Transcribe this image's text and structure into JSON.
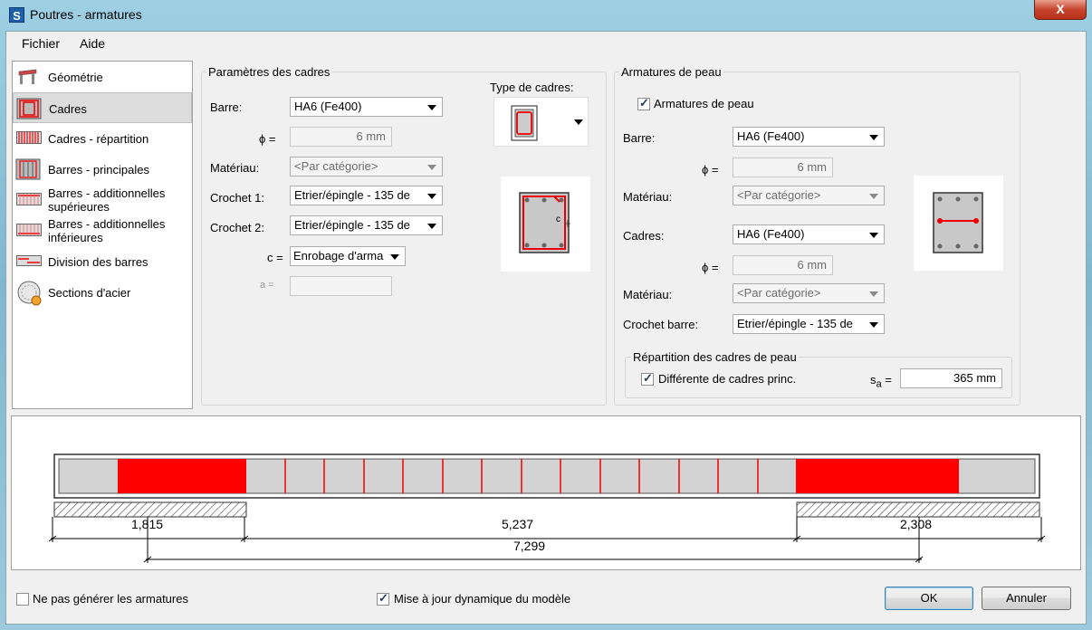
{
  "window": {
    "title": "Poutres - armatures",
    "app_icon": "S",
    "close_glyph": "X"
  },
  "menu": [
    "Fichier",
    "Aide"
  ],
  "nav": [
    {
      "label": "Géométrie",
      "icon": "geometry-icon"
    },
    {
      "label": "Cadres",
      "icon": "stirrups-icon",
      "selected": true
    },
    {
      "label": "Cadres - répartition",
      "icon": "stirrup-distribution-icon"
    },
    {
      "label": "Barres - principales",
      "icon": "main-bars-icon"
    },
    {
      "label": "Barres - additionnelles supérieures",
      "line1": "Barres - additionnelles",
      "line2": "supérieures",
      "icon": "top-bars-icon"
    },
    {
      "label": "Barres - additionnelles inférieures",
      "line1": "Barres - additionnelles",
      "line2": "inférieures",
      "icon": "bottom-bars-icon"
    },
    {
      "label": "Division des barres",
      "icon": "bar-division-icon"
    },
    {
      "label": "Sections d'acier",
      "icon": "steel-sections-icon"
    }
  ],
  "cadres": {
    "group_title": "Paramètres des cadres",
    "barre_label": "Barre:",
    "barre_value": "HA6 (Fe400)",
    "phi_label": "ϕ =",
    "phi_value": "6 mm",
    "materiau_label": "Matériau:",
    "materiau_value": "<Par catégorie>",
    "crochet1_label": "Crochet 1:",
    "crochet1_value": "Etrier/épingle - 135 de",
    "crochet2_label": "Crochet 2:",
    "crochet2_value": "Etrier/épingle - 135 de",
    "c_label": "c =",
    "c_value": "Enrobage d'arma",
    "a_label": "a =",
    "a_value": "",
    "type_label": "Type de cadres:",
    "section_c_label": "c"
  },
  "peau": {
    "group_title": "Armatures de peau",
    "enable_label": "Armatures de peau",
    "enable_checked": true,
    "barre_label": "Barre:",
    "barre_value": "HA6 (Fe400)",
    "phi_label": "ϕ =",
    "phi_value": "6 mm",
    "materiau_label": "Matériau:",
    "materiau_value": "<Par catégorie>",
    "cadres_label": "Cadres:",
    "cadres_value": "HA6 (Fe400)",
    "phi2_label": "ϕ =",
    "phi2_value": "6 mm",
    "materiau2_label": "Matériau:",
    "materiau2_value": "<Par catégorie>",
    "crochet_label": "Crochet barre:",
    "crochet_value": "Etrier/épingle - 135 de",
    "repartition_title": "Répartition des cadres de peau",
    "different_label": "Différente de cadres princ.",
    "different_checked": true,
    "sa_label": "s",
    "sa_sub": "a",
    "sa_eq": "=",
    "sa_value": "365 mm"
  },
  "beam": {
    "dims": {
      "left_support": "1,815",
      "middle": "5,237",
      "right_support": "2,308",
      "total": "7,299"
    },
    "dense_color": "#ff0000",
    "stirrup_color": "#ff0000"
  },
  "footer": {
    "no_generate_label": "Ne pas générer les armatures",
    "no_generate_checked": false,
    "dynamic_update_label": "Mise à jour dynamique du modèle",
    "dynamic_update_checked": true,
    "ok_label": "OK",
    "cancel_label": "Annuler"
  }
}
